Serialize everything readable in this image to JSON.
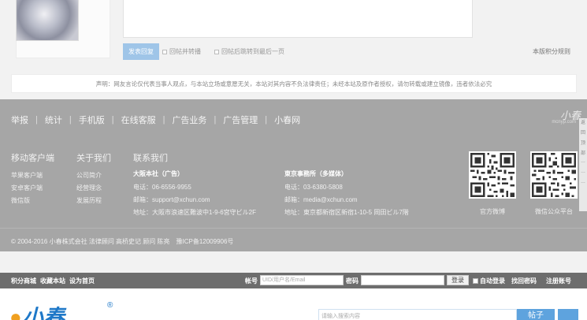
{
  "reply": {
    "submit_label": "发表回复",
    "option_forward": "回帖并转播",
    "option_jump": "回帖后跳转到最后一页",
    "rules_link": "本版积分规则"
  },
  "disclaimer": "声明：网友言论仅代表当事人观点，与本站立场或意愿无关，本站对其内容不负法律责任；未经本站及原作者授权，请勿转载或建立镜像，违者依法必究",
  "footer": {
    "nav": [
      "举报",
      "统计",
      "手机版",
      "在线客服",
      "广告业务",
      "广告管理",
      "小春网"
    ],
    "logo_text": "小春",
    "logo_sub": "mcnyp.com",
    "side_tabs": [
      "返",
      "回",
      "顶",
      "部",
      "…",
      "…",
      "…"
    ],
    "mobile": {
      "title": "移动客户端",
      "links": [
        "苹果客户端",
        "安卓客户端",
        "微信版"
      ]
    },
    "about": {
      "title": "关于我们",
      "links": [
        "公司简介",
        "经营理念",
        "发展历程"
      ]
    },
    "contact": {
      "title": "联系我们",
      "osaka": {
        "head": "大阪本社（广告）",
        "phone": "电话：06-6556-9955",
        "email": "邮箱：support@xchun.com",
        "address": "地址：大阪市浪速区難波中1-9-6宮守ビル2F"
      },
      "tokyo": {
        "head": "東京事務所（多媒体）",
        "phone": "电话：03-6380-5808",
        "email": "邮箱：media@xchun.com",
        "address": "地址：東京都新宿区新宿1-10-5 岡田ビル7階"
      }
    },
    "qr_weibo": "官方微博",
    "qr_wechat": "微信公众平台",
    "copyright": "© 2004-2016 小春株式会社 法律顾问 高桥史记 顾问 陈亮　豫ICP备12009906号"
  },
  "topbar": {
    "links": [
      "积分商城",
      "收藏本站",
      "设为首页"
    ],
    "account_label": "帐号",
    "account_placeholder": "UID/用户名/Email",
    "password_label": "密码",
    "login_button": "登录",
    "auto_login": "自动登录",
    "forgot": "找回密码",
    "register": "注册账号"
  },
  "header": {
    "logo": "小春",
    "search_placeholder": "请输入搜索内容",
    "search_button": "帖子"
  }
}
